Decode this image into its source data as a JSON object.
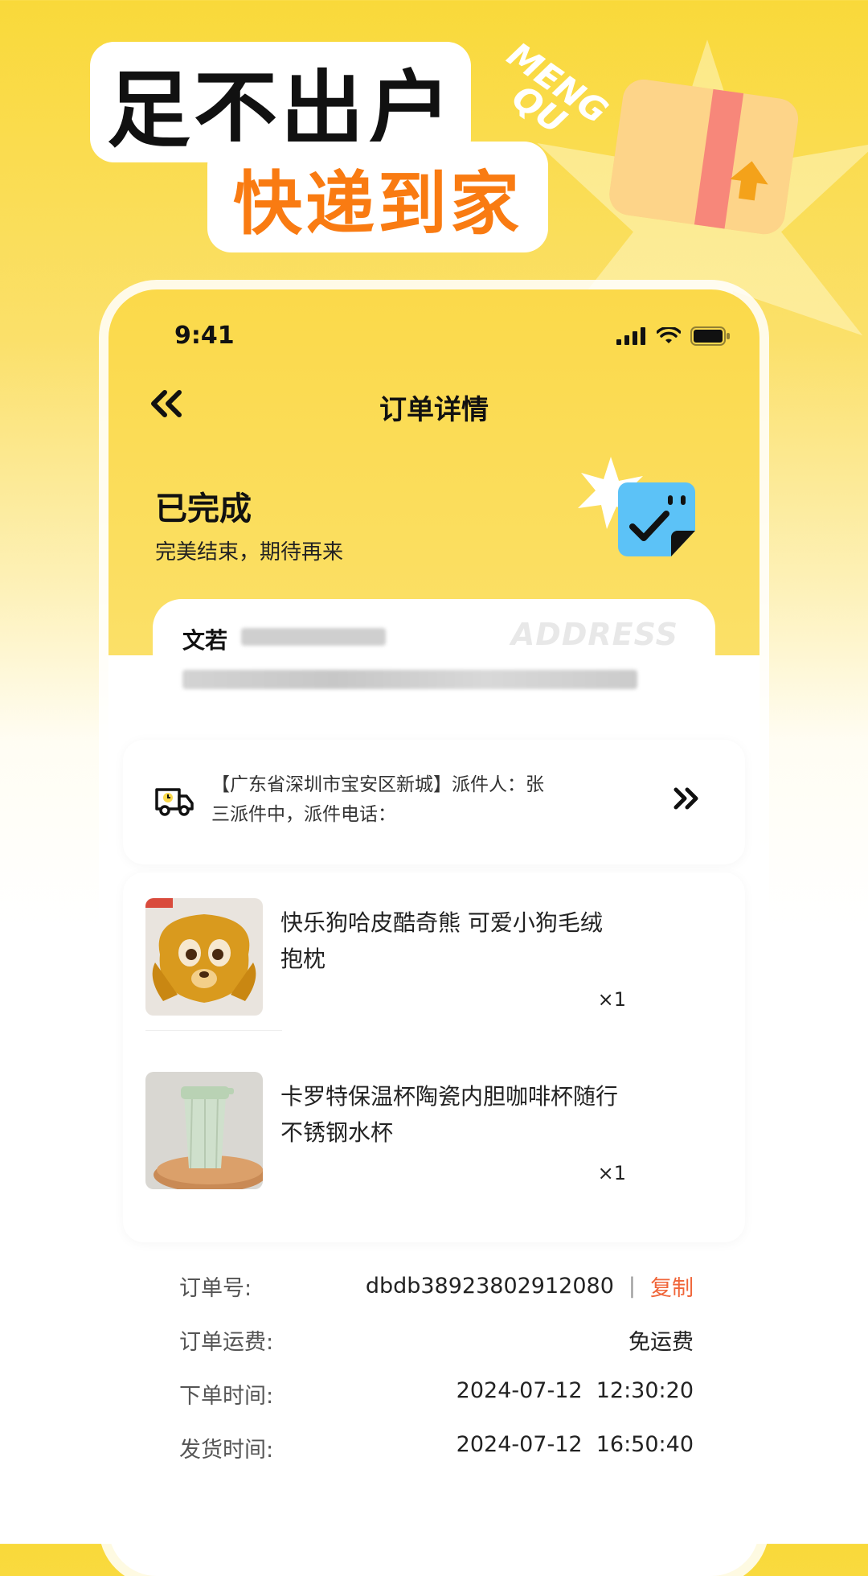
{
  "promo": {
    "headline_line1": "足不出户",
    "headline_line2": "快递到家",
    "brand_mark": "MENG\nQU"
  },
  "status_bar": {
    "time": "9:41"
  },
  "header": {
    "title": "订单详情"
  },
  "order_status": {
    "title": "已完成",
    "subtitle": "完美结束，期待再来"
  },
  "address": {
    "recipient_name": "文若",
    "watermark": "ADDRESS"
  },
  "logistics": {
    "text": "【广东省深圳市宝安区新城】派件人：张三派件中，派件电话："
  },
  "products": [
    {
      "name": "快乐狗哈皮酷奇熊 可爱小狗毛绒抱枕",
      "qty": "×1"
    },
    {
      "name": "卡罗特保温杯陶瓷内胆咖啡杯随行不锈钢水杯",
      "qty": "×1"
    }
  ],
  "order_info": {
    "order_no_label": "订单号:",
    "order_no": "dbdb38923802912080",
    "separator": "|",
    "copy_label": "复制",
    "shipping_fee_label": "订单运费:",
    "shipping_fee": "免运费",
    "order_time_label": "下单时间:",
    "order_time": "2024-07-12  12:30:20",
    "ship_time_label": "发货时间:",
    "ship_time": "2024-07-12  16:50:40"
  },
  "colors": {
    "accent": "#f97b12",
    "brand_yellow": "#fbd94a",
    "copy": "#f0663a"
  }
}
